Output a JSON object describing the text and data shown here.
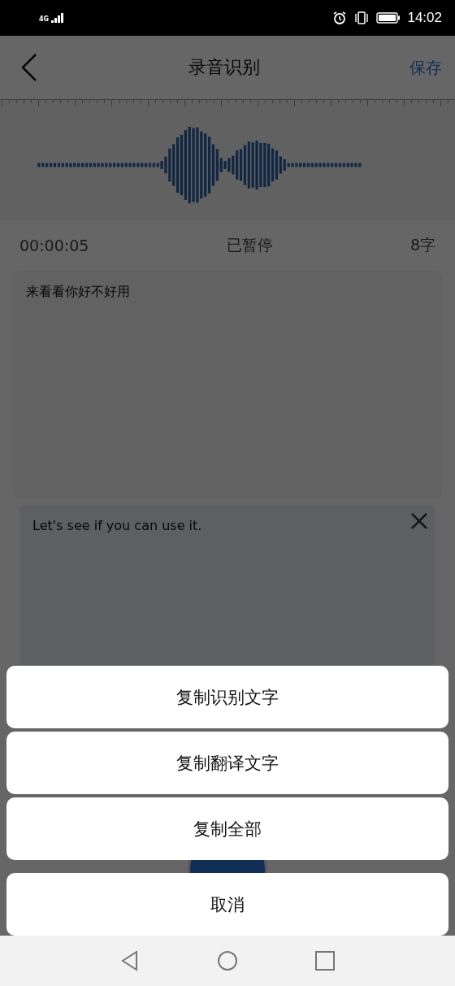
{
  "status_bar": {
    "network": "4G",
    "time": "14:02"
  },
  "header": {
    "title": "录音识别",
    "save": "保存"
  },
  "recording": {
    "elapsed": "00:00:05",
    "status": "已暂停",
    "char_count": "8字"
  },
  "transcript": {
    "text": "来看看你好不好用"
  },
  "translation": {
    "text": "Let's see if you can use it."
  },
  "action_sheet": {
    "options": [
      "复制识别文字",
      "复制翻译文字",
      "复制全部"
    ],
    "cancel": "取消"
  }
}
